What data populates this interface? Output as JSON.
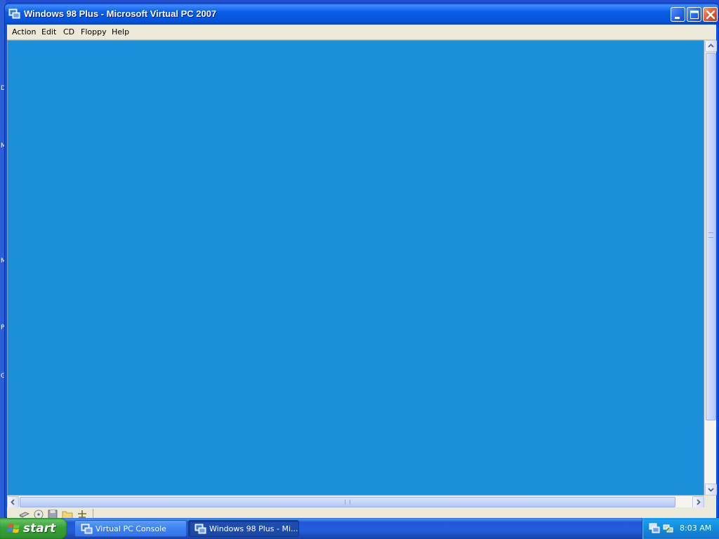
{
  "desktop": {
    "edge_chars": [
      "D",
      "M",
      "M",
      "P",
      "G"
    ]
  },
  "window": {
    "title": "Windows 98 Plus - Microsoft Virtual PC 2007",
    "icon": "virtual-pc-icon",
    "caption_buttons": [
      "minimize",
      "maximize",
      "close"
    ],
    "menu": [
      {
        "label": "Action"
      },
      {
        "label": "Edit"
      },
      {
        "label": "CD"
      },
      {
        "label": "Floppy"
      },
      {
        "label": "Help"
      }
    ],
    "vm_screen_color": "#1b8fd9",
    "status_icons": [
      "hard-disk-icon",
      "cd-drive-icon",
      "floppy-icon",
      "shared-folder-icon",
      "network-icon"
    ]
  },
  "taskbar": {
    "start_label": "start",
    "tasks": [
      {
        "label": "Virtual PC Console",
        "icon": "virtual-pc-icon",
        "active": false
      },
      {
        "label": "Windows 98 Plus - Mi...",
        "icon": "virtual-pc-icon",
        "active": true
      }
    ],
    "tray": {
      "icons": [
        "virtual-pc-tray-icon",
        "network-tray-icon"
      ],
      "clock": "8:03 AM"
    }
  },
  "colors": {
    "title_blue": "#0a5ee8",
    "taskbar_blue": "#245edb",
    "start_green": "#37a137",
    "menu_bg": "#ece9d8"
  }
}
